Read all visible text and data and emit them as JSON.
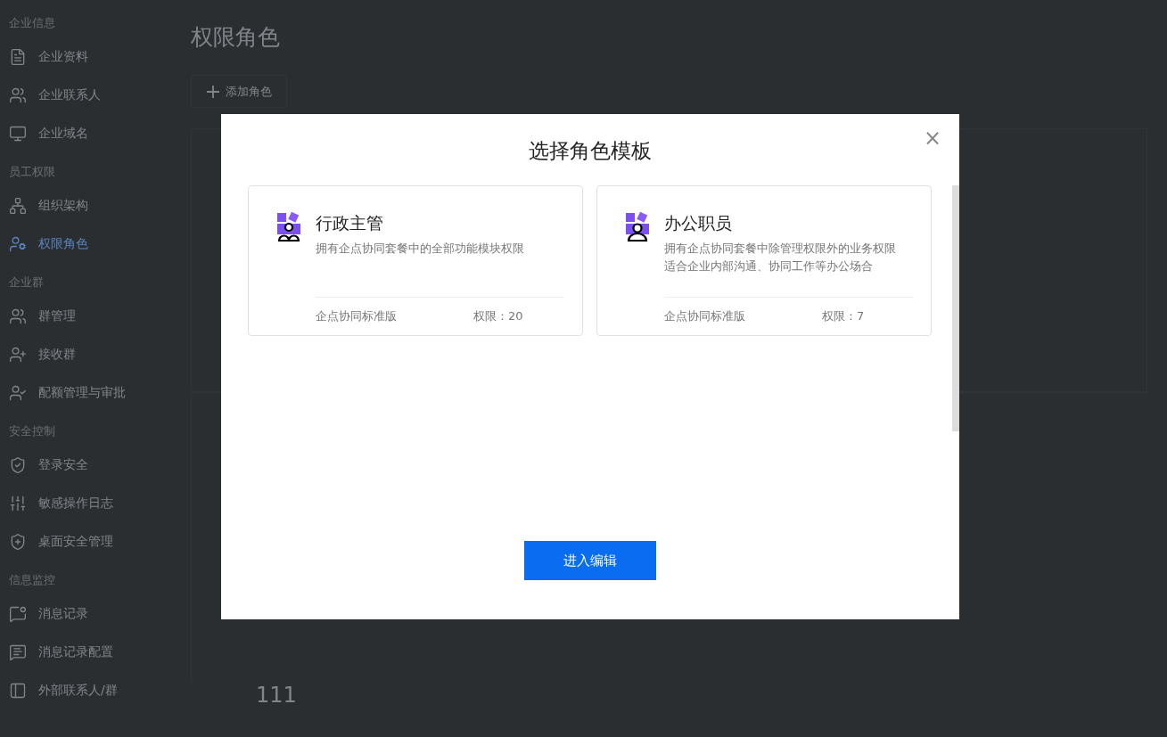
{
  "sidebar": {
    "groups": [
      {
        "title": "企业信息",
        "items": [
          {
            "label": "企业资料",
            "selected": false
          },
          {
            "label": "企业联系人",
            "selected": false
          },
          {
            "label": "企业域名",
            "selected": false
          }
        ]
      },
      {
        "title": "员工权限",
        "items": [
          {
            "label": "组织架构",
            "selected": false
          },
          {
            "label": "权限角色",
            "selected": true
          }
        ]
      },
      {
        "title": "企业群",
        "items": [
          {
            "label": "群管理",
            "selected": false
          },
          {
            "label": "接收群",
            "selected": false
          },
          {
            "label": "配额管理与审批",
            "selected": false
          }
        ]
      },
      {
        "title": "安全控制",
        "items": [
          {
            "label": "登录安全",
            "selected": false
          },
          {
            "label": "敏感操作日志",
            "selected": false
          },
          {
            "label": "桌面安全管理",
            "selected": false
          }
        ]
      },
      {
        "title": "信息监控",
        "items": [
          {
            "label": "消息记录",
            "selected": false
          },
          {
            "label": "消息记录配置",
            "selected": false
          },
          {
            "label": "外部联系人/群",
            "selected": false
          }
        ]
      }
    ]
  },
  "page": {
    "title": "权限角色",
    "add_button": "添加角色",
    "panel_text": "111"
  },
  "modal": {
    "title": "选择角色模板",
    "close": "×",
    "cards": [
      {
        "title": "行政主管",
        "description": [
          "拥有企点协同套餐中的全部功能模块权限"
        ],
        "edition": "企点协同标准版",
        "permissions": "权限：20"
      },
      {
        "title": "办公职员",
        "description": [
          "拥有企点协同套餐中除管理权限外的业务权限",
          "适合企业内部沟通、协同工作等办公场合"
        ],
        "edition": "企点协同标准版",
        "permissions": "权限：7"
      }
    ],
    "confirm_button": "进入编辑"
  }
}
